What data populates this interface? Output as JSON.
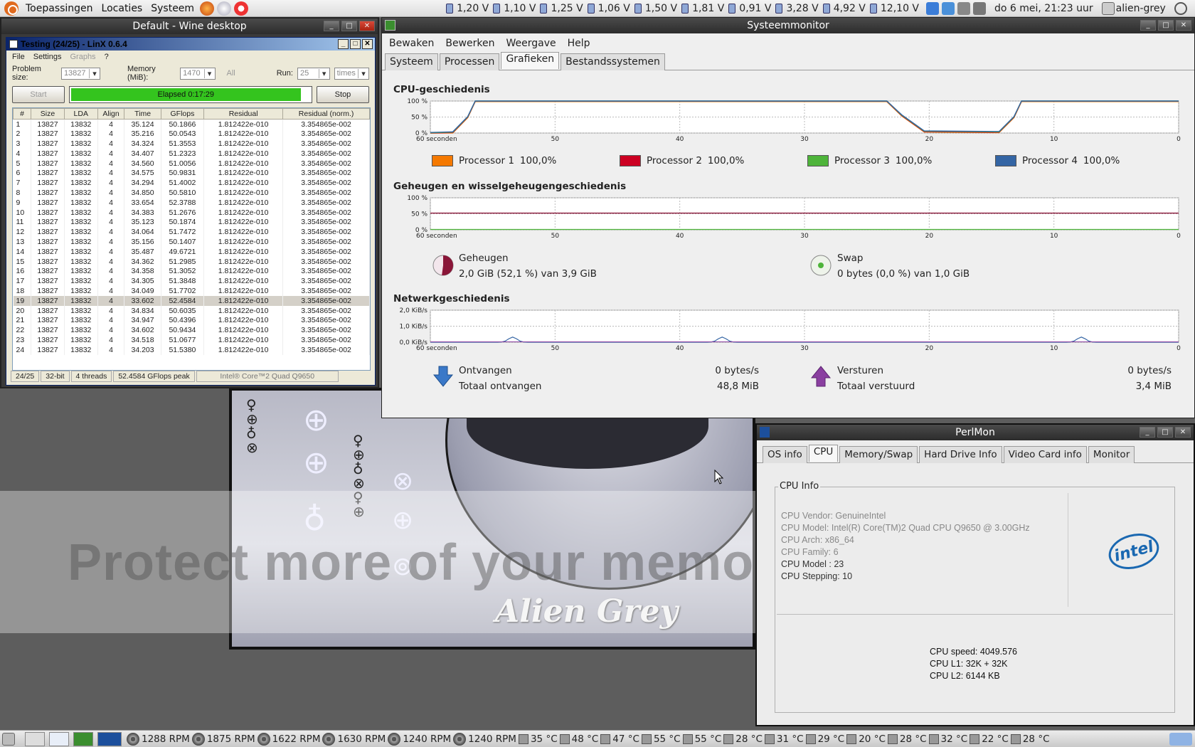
{
  "top_panel": {
    "menus": [
      "Toepassingen",
      "Locaties",
      "Systeem"
    ],
    "voltages": [
      "1,20 V",
      "1,10 V",
      "1,25 V",
      "1,06 V",
      "1,50 V",
      "1,81 V",
      "0,91 V",
      "3,28 V",
      "4,92 V",
      "12,10 V"
    ],
    "clock": "do  6 mei, 21:23 uur",
    "user": "alien-grey"
  },
  "wallpaper": {
    "caption": "Alien Grey",
    "watermark": "Protect more of your memories for less!"
  },
  "wine": {
    "title": "Default - Wine desktop"
  },
  "linx": {
    "title": "Testing (24/25) - LinX 0.6.4",
    "menu": [
      "File",
      "Settings",
      "Graphs",
      "?"
    ],
    "problem_size_label": "Problem size:",
    "problem_size": "13827",
    "memory_label": "Memory (MiB):",
    "memory": "1470",
    "all_label": "All",
    "run_label": "Run:",
    "run": "25",
    "run_unit": "times",
    "start_label": "Start",
    "stop_label": "Stop",
    "elapsed": "Elapsed 0:17:29",
    "progress": 0.96,
    "columns": [
      "#",
      "Size",
      "LDA",
      "Align",
      "Time",
      "GFlops",
      "Residual",
      "Residual (norm.)"
    ],
    "rows": [
      [
        "1",
        "13827",
        "13832",
        "4",
        "35.124",
        "50.1866",
        "1.812422e-010",
        "3.354865e-002"
      ],
      [
        "2",
        "13827",
        "13832",
        "4",
        "35.216",
        "50.0543",
        "1.812422e-010",
        "3.354865e-002"
      ],
      [
        "3",
        "13827",
        "13832",
        "4",
        "34.324",
        "51.3553",
        "1.812422e-010",
        "3.354865e-002"
      ],
      [
        "4",
        "13827",
        "13832",
        "4",
        "34.407",
        "51.2323",
        "1.812422e-010",
        "3.354865e-002"
      ],
      [
        "5",
        "13827",
        "13832",
        "4",
        "34.560",
        "51.0056",
        "1.812422e-010",
        "3.354865e-002"
      ],
      [
        "6",
        "13827",
        "13832",
        "4",
        "34.575",
        "50.9831",
        "1.812422e-010",
        "3.354865e-002"
      ],
      [
        "7",
        "13827",
        "13832",
        "4",
        "34.294",
        "51.4002",
        "1.812422e-010",
        "3.354865e-002"
      ],
      [
        "8",
        "13827",
        "13832",
        "4",
        "34.850",
        "50.5810",
        "1.812422e-010",
        "3.354865e-002"
      ],
      [
        "9",
        "13827",
        "13832",
        "4",
        "33.654",
        "52.3788",
        "1.812422e-010",
        "3.354865e-002"
      ],
      [
        "10",
        "13827",
        "13832",
        "4",
        "34.383",
        "51.2676",
        "1.812422e-010",
        "3.354865e-002"
      ],
      [
        "11",
        "13827",
        "13832",
        "4",
        "35.123",
        "50.1874",
        "1.812422e-010",
        "3.354865e-002"
      ],
      [
        "12",
        "13827",
        "13832",
        "4",
        "34.064",
        "51.7472",
        "1.812422e-010",
        "3.354865e-002"
      ],
      [
        "13",
        "13827",
        "13832",
        "4",
        "35.156",
        "50.1407",
        "1.812422e-010",
        "3.354865e-002"
      ],
      [
        "14",
        "13827",
        "13832",
        "4",
        "35.487",
        "49.6721",
        "1.812422e-010",
        "3.354865e-002"
      ],
      [
        "15",
        "13827",
        "13832",
        "4",
        "34.362",
        "51.2985",
        "1.812422e-010",
        "3.354865e-002"
      ],
      [
        "16",
        "13827",
        "13832",
        "4",
        "34.358",
        "51.3052",
        "1.812422e-010",
        "3.354865e-002"
      ],
      [
        "17",
        "13827",
        "13832",
        "4",
        "34.305",
        "51.3848",
        "1.812422e-010",
        "3.354865e-002"
      ],
      [
        "18",
        "13827",
        "13832",
        "4",
        "34.049",
        "51.7702",
        "1.812422e-010",
        "3.354865e-002"
      ],
      [
        "19",
        "13827",
        "13832",
        "4",
        "33.602",
        "52.4584",
        "1.812422e-010",
        "3.354865e-002"
      ],
      [
        "20",
        "13827",
        "13832",
        "4",
        "34.834",
        "50.6035",
        "1.812422e-010",
        "3.354865e-002"
      ],
      [
        "21",
        "13827",
        "13832",
        "4",
        "34.947",
        "50.4396",
        "1.812422e-010",
        "3.354865e-002"
      ],
      [
        "22",
        "13827",
        "13832",
        "4",
        "34.602",
        "50.9434",
        "1.812422e-010",
        "3.354865e-002"
      ],
      [
        "23",
        "13827",
        "13832",
        "4",
        "34.518",
        "51.0677",
        "1.812422e-010",
        "3.354865e-002"
      ],
      [
        "24",
        "13827",
        "13832",
        "4",
        "34.203",
        "51.5380",
        "1.812422e-010",
        "3.354865e-002"
      ]
    ],
    "selected_row": 19,
    "status": [
      "24/25",
      "32-bit",
      "4 threads",
      "52.4584 GFlops peak",
      "Intel® Core™2 Quad Q9650"
    ]
  },
  "sysmon": {
    "title": "Systeemmonitor",
    "menu": [
      "Bewaken",
      "Bewerken",
      "Weergave",
      "Help"
    ],
    "tabs": [
      "Systeem",
      "Processen",
      "Grafieken",
      "Bestandssystemen"
    ],
    "active_tab": "Grafieken",
    "cpu_title": "CPU-geschiedenis",
    "mem_title": "Geheugen en wisselgeheugengeschiedenis",
    "net_title": "Netwerkgeschiedenis",
    "pct_ticks": [
      "100 %",
      "50 %",
      "0 %"
    ],
    "net_ticks": [
      "2,0 KiB/s",
      "1,0 KiB/s",
      "0,0 KiB/s"
    ],
    "time_ticks": [
      "60 seconden",
      "50",
      "40",
      "30",
      "20",
      "10",
      "0"
    ],
    "processors": [
      {
        "name": "Processor 1",
        "value": "100,0%",
        "color": "#f57900"
      },
      {
        "name": "Processor 2",
        "value": "100,0%",
        "color": "#cc0022"
      },
      {
        "name": "Processor 3",
        "value": "100,0%",
        "color": "#4eb43a"
      },
      {
        "name": "Processor 4",
        "value": "100,0%",
        "color": "#3465a4"
      }
    ],
    "memory": {
      "label": "Geheugen",
      "detail": "2,0 GiB (52,1 %) van 3,9 GiB",
      "fraction": 0.521
    },
    "swap": {
      "label": "Swap",
      "detail": "0 bytes (0,0 %) van 1,0 GiB"
    },
    "net": {
      "recv_label": "Ontvangen",
      "recv_value": "0 bytes/s",
      "recv_total_label": "Totaal ontvangen",
      "recv_total": "48,8 MiB",
      "send_label": "Versturen",
      "send_value": "0 bytes/s",
      "send_total_label": "Totaal verstuurd",
      "send_total": "3,4 MiB"
    }
  },
  "perfmon": {
    "title": "PerlMon",
    "tabs": [
      "OS info",
      "CPU",
      "Memory/Swap",
      "Hard Drive Info",
      "Video Card info",
      "Monitor"
    ],
    "active_tab": "CPU",
    "group_label": "CPU Info",
    "lines": [
      "CPU Vendor: GenuineIntel",
      "CPU Model: Intel(R) Core(TM)2 Quad CPU    Q9650  @ 3.00GHz",
      "CPU Arch: x86_64",
      "CPU Family: 6",
      "CPU Model : 23",
      "CPU Stepping: 10"
    ],
    "logo": "intel",
    "stats": [
      "CPU speed: 4049.576",
      "CPU L1: 32K + 32K",
      "CPU L2: 6144 KB"
    ]
  },
  "bottom_panel": {
    "fans": [
      "1288 RPM",
      "1875 RPM",
      "1622 RPM",
      "1630 RPM",
      "1240 RPM",
      "1240 RPM"
    ],
    "temps": [
      "35 °C",
      "48 °C",
      "47 °C",
      "55 °C",
      "55 °C",
      "28 °C",
      "31 °C",
      "29 °C",
      "20 °C",
      "28 °C",
      "32 °C",
      "22 °C",
      "28 °C"
    ]
  }
}
